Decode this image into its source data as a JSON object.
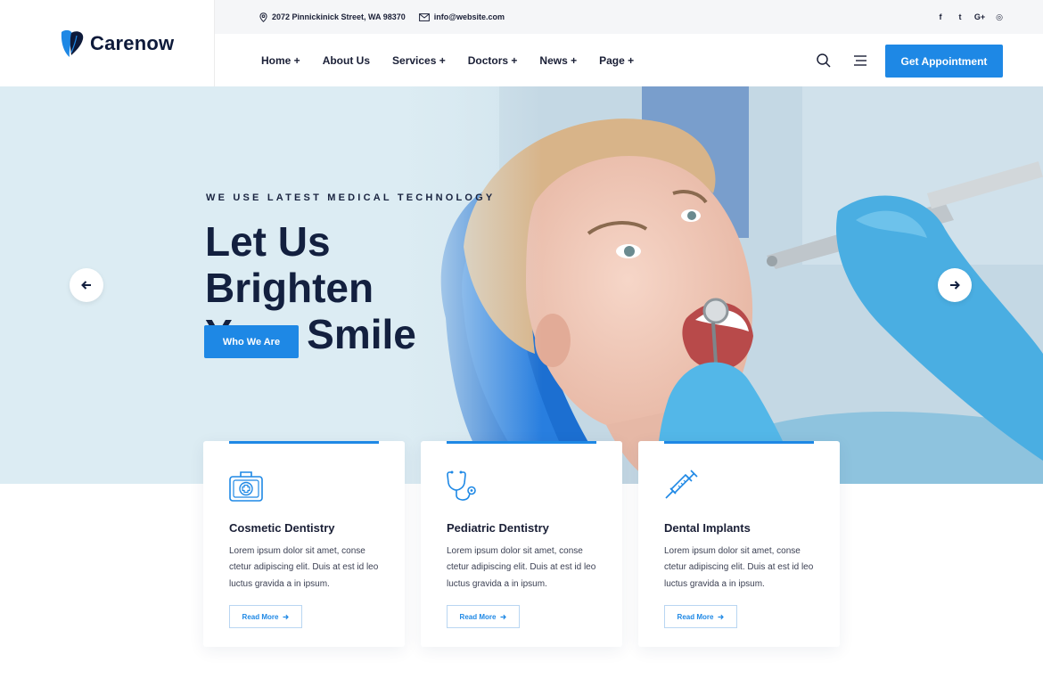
{
  "brand": {
    "name": "Carenow",
    "accent": "#1e88e5",
    "dark": "#13203f"
  },
  "topbar": {
    "address": "2072 Pinnickinick Street, WA 98370",
    "email": "info@website.com",
    "social_icons": [
      "facebook-icon",
      "twitter-icon",
      "google-plus-icon",
      "instagram-icon"
    ],
    "social_glyphs": [
      "f",
      "t",
      "G+",
      "◎"
    ]
  },
  "nav": {
    "items": [
      "Home +",
      "About Us",
      "Services +",
      "Doctors +",
      "News +",
      "Page +"
    ],
    "appointment_label": "Get Appointment"
  },
  "hero": {
    "subtitle": "WE USE LATEST MEDICAL TECHNOLOGY",
    "title_line1": "Let Us Brighten",
    "title_line2": "Your Smile",
    "button_label": "Who We Are"
  },
  "cards": [
    {
      "title": "Cosmetic Dentistry",
      "text": "Lorem ipsum dolor sit amet, conse ctetur adipiscing elit. Duis at est id leo luctus gravida a in ipsum.",
      "more": "Read More",
      "icon": "first-aid-kit-icon"
    },
    {
      "title": "Pediatric Dentistry",
      "text": "Lorem ipsum dolor sit amet, conse ctetur adipiscing elit. Duis at est id leo luctus gravida a in ipsum.",
      "more": "Read More",
      "icon": "stethoscope-icon"
    },
    {
      "title": "Dental Implants",
      "text": "Lorem ipsum dolor sit amet, conse ctetur adipiscing elit. Duis at est id leo luctus gravida a in ipsum.",
      "more": "Read More",
      "icon": "syringe-icon"
    }
  ]
}
